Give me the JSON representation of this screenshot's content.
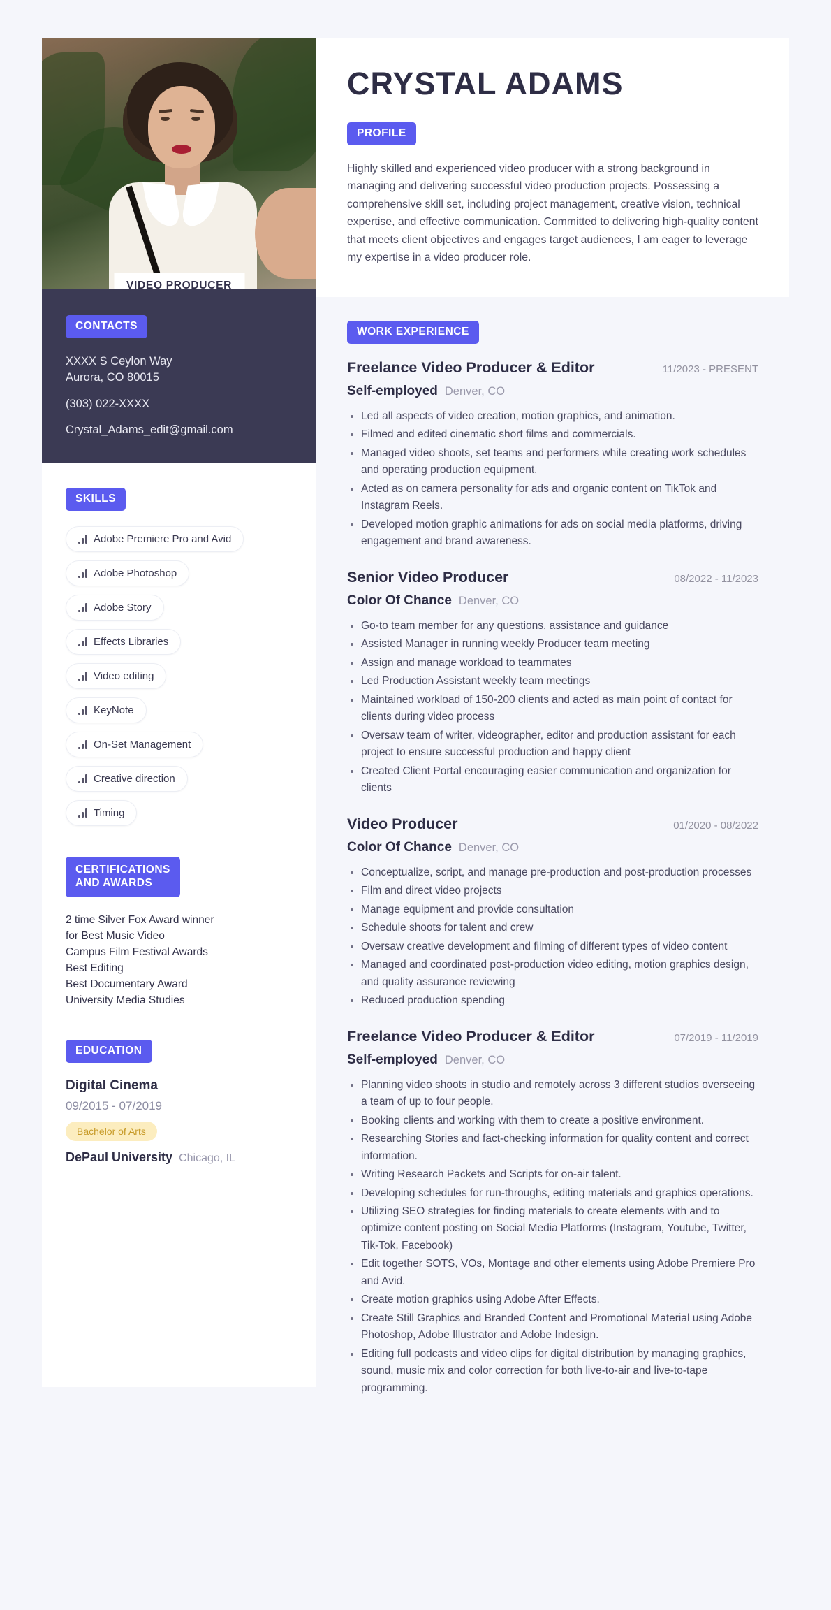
{
  "theme": {
    "accent": "#5b5bef",
    "dark_panel": "#3b3a54",
    "page_bg": "#f5f6fb",
    "badge_yellow_bg": "#fcedbf",
    "badge_yellow_text": "#c79a27"
  },
  "header": {
    "name": "CRYSTAL ADAMS",
    "role_badge": "VIDEO PRODUCER"
  },
  "profile": {
    "heading": "PROFILE",
    "text": "Highly skilled and experienced video producer with a strong background in managing and delivering successful video production projects. Possessing a comprehensive skill set, including project management, creative vision, technical expertise, and effective communication. Committed to delivering high-quality content that meets client objectives and engages target audiences, I am eager to leverage my expertise in a video producer role."
  },
  "contacts": {
    "heading": "CONTACTS",
    "address_line1": "XXXX S Ceylon Way",
    "address_line2": "Aurora, CO 80015",
    "phone": "(303) 022-XXXX",
    "email": "Crystal_Adams_edit@gmail.com"
  },
  "skills": {
    "heading": "SKILLS",
    "icon": "signal-bars-icon",
    "items": [
      "Adobe Premiere Pro and Avid",
      "Adobe Photoshop",
      "Adobe Story",
      "Effects Libraries",
      "Video editing",
      "KeyNote",
      "On-Set Management",
      "Creative direction",
      "Timing"
    ]
  },
  "certifications": {
    "heading": "CERTIFICATIONS AND AWARDS",
    "heading_line1": "CERTIFICATIONS",
    "heading_line2": "AND AWARDS",
    "lines": [
      "2 time Silver Fox Award winner",
      "for Best Music Video",
      "Campus Film Festival Awards",
      "Best Editing",
      "Best Documentary Award",
      "University Media Studies"
    ]
  },
  "education": {
    "heading": "EDUCATION",
    "items": [
      {
        "degree": "Digital Cinema",
        "dates": "09/2015 - 07/2019",
        "badge": "Bachelor of Arts",
        "school": "DePaul University",
        "location": "Chicago, IL"
      }
    ]
  },
  "work_experience": {
    "heading": "WORK EXPERIENCE",
    "items": [
      {
        "title": "Freelance Video Producer & Editor",
        "dates": "11/2023 - PRESENT",
        "company": "Self-employed",
        "location": "Denver, CO",
        "bullets": [
          "Led all aspects of video creation, motion graphics, and animation.",
          "Filmed and edited cinematic short films and commercials.",
          "Managed video shoots, set teams and performers while creating work schedules and operating production equipment.",
          "Acted as on camera personality for ads and organic content on TikTok and Instagram Reels.",
          "Developed motion graphic animations for ads on social media platforms, driving engagement and brand awareness."
        ]
      },
      {
        "title": "Senior Video Producer",
        "dates": "08/2022 - 11/2023",
        "company": "Color Of Chance",
        "location": "Denver, CO",
        "bullets": [
          "Go-to team member for any questions, assistance and guidance",
          "Assisted Manager in running weekly Producer team meeting",
          "Assign and manage workload to teammates",
          "Led Production Assistant weekly team meetings",
          "Maintained workload of 150-200 clients and acted as main point of contact for clients during video process",
          "Oversaw team of writer, videographer, editor and production assistant for each project to ensure successful production and happy client",
          "Created Client Portal encouraging easier communication and organization for clients"
        ]
      },
      {
        "title": "Video Producer",
        "dates": "01/2020 - 08/2022",
        "company": "Color Of Chance",
        "location": "Denver, CO",
        "bullets": [
          "Conceptualize, script, and manage pre-production and post-production processes",
          "Film and direct video projects",
          "Manage equipment and provide consultation",
          "Schedule shoots for talent and crew",
          "Oversaw creative development and filming of different types of video content",
          "Managed and coordinated post-production video editing, motion graphics design, and quality assurance reviewing",
          "Reduced production spending"
        ]
      },
      {
        "title": "Freelance Video Producer & Editor",
        "dates": "07/2019 - 11/2019",
        "company": "Self-employed",
        "location": "Denver, CO",
        "bullets": [
          "Planning video shoots in studio and remotely across 3 different studios overseeing a team of up to four people.",
          "Booking clients and working with them to create a positive environment.",
          "Researching Stories and fact-checking information for quality content and correct information.",
          "Writing Research Packets and Scripts for on-air talent.",
          "Developing schedules for run-throughs, editing materials and graphics operations.",
          "Utilizing SEO strategies for finding materials to create elements with and to optimize content posting on Social Media Platforms (Instagram, Youtube, Twitter, Tik-Tok, Facebook)",
          "Edit together SOTS, VOs, Montage and other elements using Adobe Premiere Pro and Avid.",
          "Create motion graphics using Adobe After Effects.",
          "Create Still Graphics and Branded Content and Promotional Material using Adobe Photoshop, Adobe Illustrator and Adobe Indesign.",
          "Editing full podcasts and video clips for digital distribution by managing graphics, sound, music mix and color correction for both live-to-air and live-to-tape programming."
        ]
      }
    ]
  }
}
